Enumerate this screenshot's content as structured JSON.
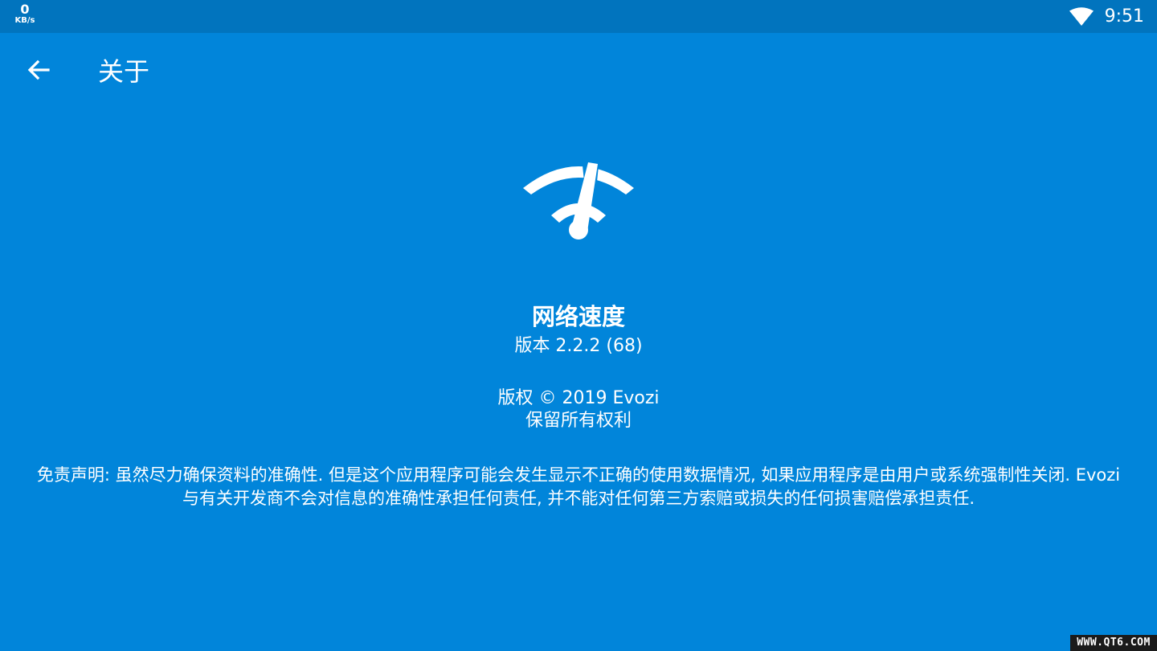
{
  "status_bar": {
    "net_speed_value": "0",
    "net_speed_unit": "KB/s",
    "clock": "9:51",
    "wifi_icon": "wifi-icon"
  },
  "app_bar": {
    "back_icon": "arrow-back-icon",
    "title": "关于"
  },
  "about": {
    "logo_icon": "speedometer-wifi-icon",
    "app_name": "网络速度",
    "version": "版本 2.2.2 (68)",
    "copyright_line1": "版权 © 2019 Evozi",
    "copyright_line2": "保留所有权利",
    "disclaimer": "免责声明: 虽然尽力确保资料的准确性. 但是这个应用程序可能会发生显示不正确的使用数据情况, 如果应用程序是由用户或系统强制性关闭. Evozi与有关开发商不会对信息的准确性承担任何责任, 并不能对任何第三方索赔或损失的任何损害赔偿承担责任."
  },
  "watermark": "WWW.QT6.COM",
  "colors": {
    "background": "#0185DA",
    "status_bar": "#0174BE",
    "foreground": "#FFFFFF"
  }
}
